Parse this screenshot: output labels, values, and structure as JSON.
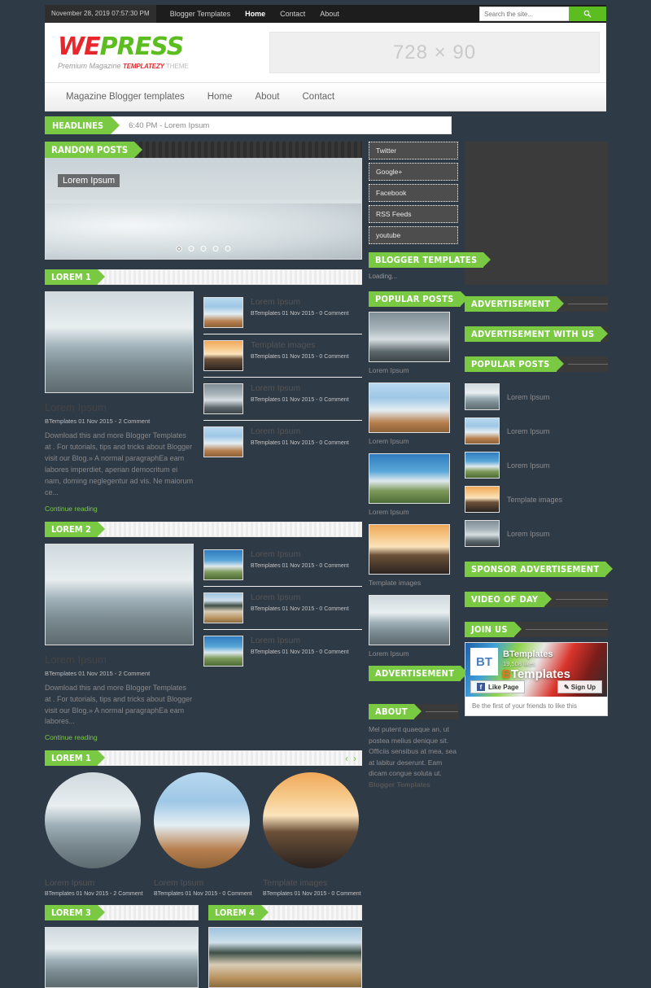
{
  "topbar": {
    "date": "November 28, 2019 07:57:30 PM",
    "nav": [
      {
        "label": "Blogger Templates",
        "active": false
      },
      {
        "label": "Home",
        "active": true
      },
      {
        "label": "Contact",
        "active": false
      },
      {
        "label": "About",
        "active": false
      }
    ],
    "search_placeholder": "Search the site..."
  },
  "header": {
    "logo_part1": "WE",
    "logo_part2": "PRESS",
    "tagline_1": "Premium Magazine ",
    "tagline_2": "TEMPLATEZY",
    "tagline_3": " THEME",
    "banner_text": "728 × 90"
  },
  "mainnav": [
    {
      "label": "Magazine Blogger templates"
    },
    {
      "label": "Home"
    },
    {
      "label": "About"
    },
    {
      "label": "Contact"
    }
  ],
  "headlines": {
    "tag": "HEADLINES",
    "text": "6:40 PM - Lorem Ipsum"
  },
  "slider": {
    "tag": "RANDOM POSTS",
    "caption": "Lorem Ipsum",
    "dots": 5,
    "active_dot": 0
  },
  "sections": {
    "lorem1": {
      "tag": "LOREM 1",
      "feature": {
        "title": "Lorem Ipsum",
        "meta": "BTemplates 01 Nov 2015 - 2 Comment",
        "excerpt": "Download this and more Blogger Templates at . For tutorials, tips and tricks about Blogger visit our Blog.» A normal paragraphEa eam labores imperdiet, aperian democritum ei nam, doming neglegentur ad vis. Ne maiorum ce...",
        "more": "Continue reading"
      },
      "items": [
        {
          "title": "Lorem Ipsum",
          "meta": "BTemplates 01 Nov 2015 - 0 Comment"
        },
        {
          "title": "Template images",
          "meta": "BTemplates 01 Nov 2015 - 0 Comment"
        },
        {
          "title": "Lorem Ipsum",
          "meta": "BTemplates 01 Nov 2015 - 0 Comment"
        },
        {
          "title": "Lorem Ipsum",
          "meta": "BTemplates 01 Nov 2015 - 0 Comment"
        }
      ]
    },
    "lorem2": {
      "tag": "LOREM 2",
      "feature": {
        "title": "Lorem Ipsum",
        "meta": "BTemplates 01 Nov 2015 - 2 Comment",
        "excerpt": "Download this and more Blogger Templates at . For tutorials, tips and tricks about Blogger visit our Blog.» A normal paragraphEa eam labores...",
        "more": "Continue reading"
      },
      "items": [
        {
          "title": "Lorem Ipsum",
          "meta": "BTemplates 01 Nov 2015 - 0 Comment"
        },
        {
          "title": "Lorem Ipsum",
          "meta": "BTemplates 01 Nov 2015 - 0 Comment"
        },
        {
          "title": "Lorem Ipsum",
          "meta": "BTemplates 01 Nov 2015 - 0 Comment"
        }
      ]
    },
    "carousel": {
      "tag": "LOREM 1",
      "prev": "‹",
      "next": "›",
      "items": [
        {
          "title": "Lorem Ipsum",
          "meta": "BTemplates 01 Nov 2015 - 2 Comment"
        },
        {
          "title": "Lorem Ipsum",
          "meta": "BTemplates 01 Nov 2015 - 0 Comment"
        },
        {
          "title": "Template images",
          "meta": "BTemplates 01 Nov 2015 - 0 Comment"
        }
      ]
    },
    "lorem3": {
      "tag": "LOREM 3"
    },
    "lorem4": {
      "tag": "LOREM 4"
    }
  },
  "midcol": {
    "social": [
      {
        "label": "Twitter"
      },
      {
        "label": "Google+"
      },
      {
        "label": "Facebook"
      },
      {
        "label": "RSS Feeds"
      },
      {
        "label": "youtube"
      }
    ],
    "blogger_templates_tag": "BLOGGER TEMPLATES",
    "loading": "Loading...",
    "popular_tag": "POPULAR POSTS",
    "popular": [
      {
        "title": "Lorem Ipsum"
      },
      {
        "title": "Lorem Ipsum"
      },
      {
        "title": "Lorem Ipsum"
      },
      {
        "title": "Template images"
      },
      {
        "title": "Lorem Ipsum"
      }
    ],
    "advertisement_tag": "ADVERTISEMENT",
    "about_tag": "ABOUT",
    "about_text": "Mel putent quaeque an, ut postea melius denique sit. Officiis sensibus at mea, sea at labitur deserunt. Eam dicam congue soluta ut. ",
    "about_link": "Blogger Templates"
  },
  "rightcol": {
    "advertisement_tag": "ADVERTISEMENT",
    "advertisement_with_us_tag": "ADVERTISEMENT WITH US",
    "popular_tag": "POPULAR POSTS",
    "popular": [
      {
        "title": "Lorem Ipsum"
      },
      {
        "title": "Lorem Ipsum"
      },
      {
        "title": "Lorem Ipsum"
      },
      {
        "title": "Template images"
      },
      {
        "title": "Lorem Ipsum"
      }
    ],
    "sponsor_tag": "SPONSOR ADVERTISEMENT",
    "video_tag": "VIDEO OF DAY",
    "join_tag": "JOIN US",
    "facebook": {
      "logo_b": "B",
      "logo_t": "T",
      "page_name": "BTemplates",
      "likes": "19,508 likes",
      "brand_b": "B",
      "brand_rest": "Templates",
      "like_button": "Like Page",
      "signup_button": "✎ Sign Up",
      "footer": "Be the first of your friends to like this"
    }
  },
  "colors": {
    "green": "#7ac943",
    "red": "#e8262b",
    "dark": "#1d1d1d"
  }
}
